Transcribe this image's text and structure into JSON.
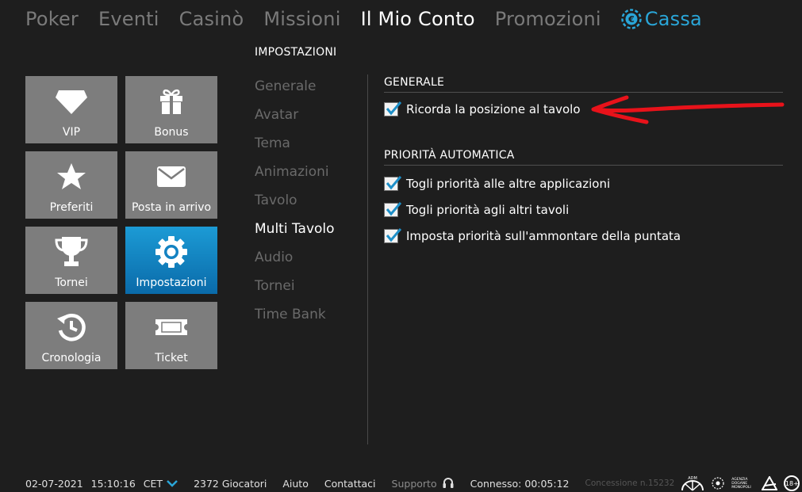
{
  "nav": {
    "items": [
      "Poker",
      "Eventi",
      "Casinò",
      "Missioni",
      "Il Mio Conto",
      "Promozioni"
    ],
    "active": "Il Mio Conto",
    "cashier_label": "Cassa",
    "cashier_icon": "chip-euro-icon"
  },
  "section_title": "IMPOSTAZIONI",
  "tiles": [
    {
      "label": "VIP",
      "icon": "diamond-icon"
    },
    {
      "label": "Bonus",
      "icon": "gift-icon"
    },
    {
      "label": "Preferiti",
      "icon": "star-icon"
    },
    {
      "label": "Posta in arrivo",
      "icon": "envelope-icon"
    },
    {
      "label": "Tornei",
      "icon": "trophy-icon"
    },
    {
      "label": "Impostazioni",
      "icon": "gear-icon",
      "active": true
    },
    {
      "label": "Cronologia",
      "icon": "history-icon"
    },
    {
      "label": "Ticket",
      "icon": "ticket-icon"
    }
  ],
  "settings_menu": {
    "items": [
      "Generale",
      "Avatar",
      "Tema",
      "Animazioni",
      "Tavolo",
      "Multi Tavolo",
      "Audio",
      "Tornei",
      "Time Bank"
    ],
    "active": "Multi Tavolo"
  },
  "panel": {
    "general": {
      "title": "GENERALE",
      "options": [
        {
          "label": "Ricorda la posizione al tavolo",
          "checked": true
        }
      ]
    },
    "priority": {
      "title": "PRIORITÀ AUTOMATICA",
      "options": [
        {
          "label": "Togli priorità alle altre applicazioni",
          "checked": true
        },
        {
          "label": "Togli priorità agli altri tavoli",
          "checked": true
        },
        {
          "label": "Imposta priorità sull'ammontare della puntata",
          "checked": true
        }
      ]
    }
  },
  "footer": {
    "date": "02-07-2021",
    "time": "15:10:16",
    "tz": "CET",
    "players": "2372 Giocatori",
    "help": "Aiuto",
    "contacts": "Contattaci",
    "support": "Supporto",
    "connected": "Connesso: 00:05:12",
    "concession": "Concessione n.15232",
    "adm_text": "ADM",
    "agency_text": "AGENZIA DOGANE MONOPOLI",
    "age_badge": "18+"
  },
  "colors": {
    "background": "#1e1e1e",
    "accent": "#2aa6d8",
    "tile": "#7d7d7d",
    "annotation": "#e8121a"
  }
}
